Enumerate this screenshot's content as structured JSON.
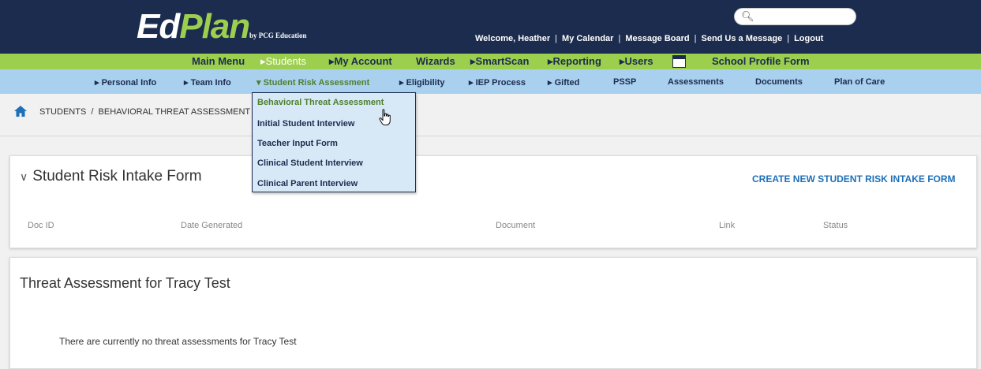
{
  "header": {
    "logo_main": "Ed",
    "logo_accent": "Plan",
    "logo_sub": "by PCG Education",
    "search_icon": "search-icon",
    "links": [
      "Welcome, Heather",
      "My Calendar",
      "Message Board",
      "Send Us a Message",
      "Logout"
    ],
    "separator": "|"
  },
  "main_nav": {
    "items": [
      "Main Menu",
      "▸Students",
      "▸My Account",
      "Wizards",
      "▸SmartScan",
      "▸Reporting",
      "▸Users",
      "School Profile Form"
    ],
    "active_index": 1
  },
  "sub_nav": {
    "items": [
      "▸ Personal Info",
      "▸ Team Info",
      "▾ Student Risk Assessment",
      "▸ Eligibility",
      "▸ IEP Process",
      "▸ Gifted",
      "PSSP",
      "Assessments",
      "Documents",
      "Plan of Care"
    ],
    "active_index": 2
  },
  "dropdown": {
    "items": [
      "Behavioral Threat Assessment",
      "Initial Student Interview",
      "Teacher Input Form",
      "Clinical Student Interview",
      "Clinical Parent Interview"
    ],
    "active_index": 0
  },
  "breadcrumb": {
    "icon": "home-icon",
    "text": "STUDENTS  /  BEHAVIORAL THREAT ASSESSMENT"
  },
  "intake_card": {
    "chevron": "∨",
    "title": "Student Risk Intake Form",
    "create_link": "CREATE NEW STUDENT RISK INTAKE FORM",
    "columns": [
      "Doc ID",
      "Date Generated",
      "Document",
      "Link",
      "Status"
    ]
  },
  "threat_card": {
    "title": "Threat Assessment for Tracy Test",
    "empty_message": "There are currently no threat assessments for Tracy Test"
  },
  "colors": {
    "header_bg": "#1c2c4e",
    "green_nav": "#9dcf4f",
    "blue_nav": "#a9d0ef",
    "link_blue": "#1d6fb8",
    "active_green": "#4f7f2f"
  }
}
